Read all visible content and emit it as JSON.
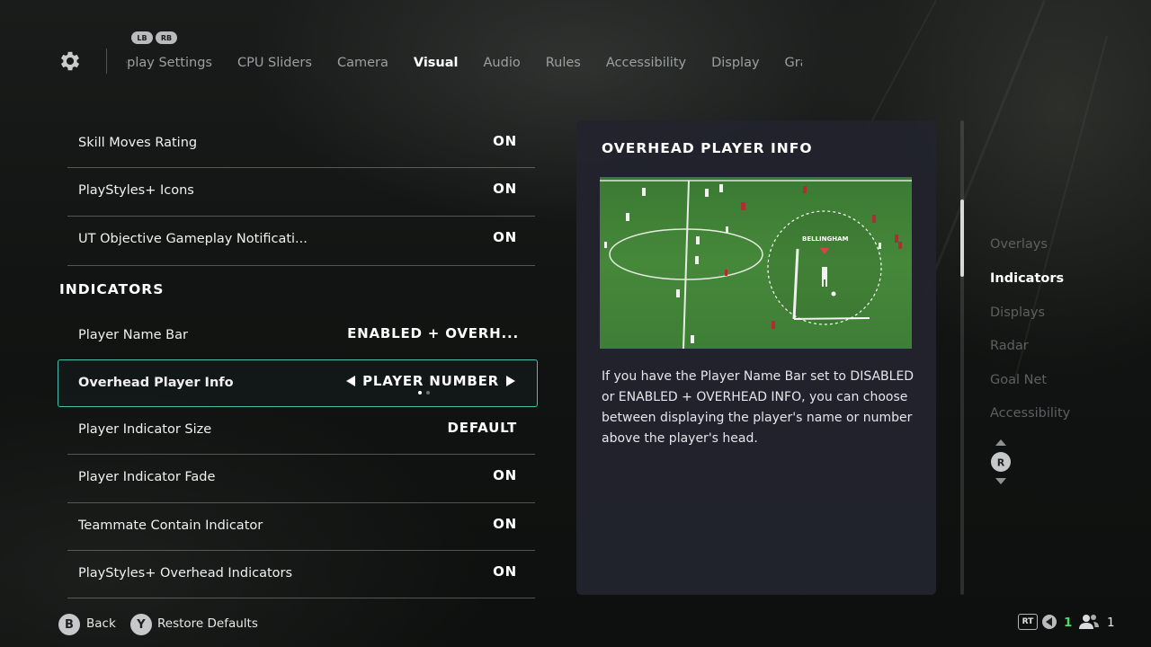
{
  "header": {
    "bumper_left": "LB",
    "bumper_right": "RB",
    "tabs": [
      {
        "label": "Gameplay Settings"
      },
      {
        "label": "CPU Sliders"
      },
      {
        "label": "Camera"
      },
      {
        "label": "Visual"
      },
      {
        "label": "Audio"
      },
      {
        "label": "Rules"
      },
      {
        "label": "Accessibility"
      },
      {
        "label": "Display"
      },
      {
        "label": "Graphics"
      }
    ],
    "active_tab": "Visual"
  },
  "settings": {
    "rows_top": [
      {
        "label": "Skill Moves Rating",
        "value": "ON"
      },
      {
        "label": "PlayStyles+ Icons",
        "value": "ON"
      },
      {
        "label": "UT Objective Gameplay Notificati...",
        "value": "ON"
      }
    ],
    "section_heading": "INDICATORS",
    "player_name_bar": {
      "label": "Player Name Bar",
      "value": "ENABLED + OVERH..."
    },
    "selected": {
      "label": "Overhead Player Info",
      "value": "PLAYER NUMBER",
      "option_index": 1,
      "option_count": 2
    },
    "rows_bottom": [
      {
        "label": "Player Indicator Size",
        "value": "DEFAULT"
      },
      {
        "label": "Player Indicator Fade",
        "value": "ON"
      },
      {
        "label": "Teammate Contain Indicator",
        "value": "ON"
      },
      {
        "label": "PlayStyles+ Overhead Indicators",
        "value": "ON"
      }
    ]
  },
  "info_panel": {
    "title": "OVERHEAD PLAYER INFO",
    "image_player_label": "BELLINGHAM",
    "description": "If you have the Player Name Bar set to DISABLED or ENABLED + OVERHEAD INFO, you can choose between displaying the player's name or number above the player's head."
  },
  "section_nav": {
    "items": [
      "Overlays",
      "Indicators",
      "Displays",
      "Radar",
      "Goal Net",
      "Accessibility"
    ],
    "active": "Indicators",
    "stick_label": "R"
  },
  "scroll_progress": 0.2,
  "footer": {
    "back_button": "B",
    "back_label": "Back",
    "restore_button": "Y",
    "restore_label": "Restore Defaults",
    "rt_label": "RT",
    "controller_count": "1",
    "player_count": "1"
  },
  "colors": {
    "accent": "#47c0b0",
    "panel": "#22232e",
    "controller_count": "#4cd964"
  }
}
